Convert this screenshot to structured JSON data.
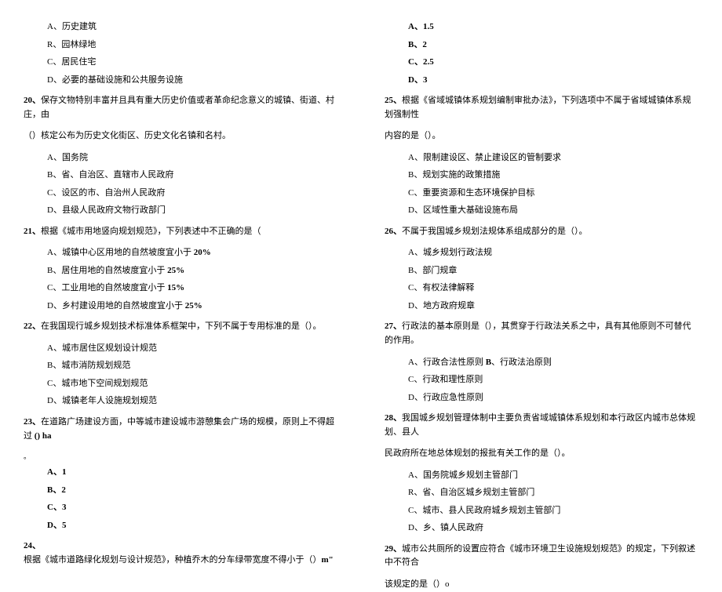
{
  "left": {
    "q19_optA": "A、历史建筑",
    "q19_optB": "R、园林绿地",
    "q19_optC": "C、居民住宅",
    "q19_optD": "D、必要的基础设施和公共服务设施",
    "q20_num": "20、",
    "q20_text1": "保存文物特别丰富并且具有重大历史价值或者革命纪念意义的城镇、街道、村庄，由",
    "q20_text2": "（）核定公布为历史文化街区、历史文化名镇和名村。",
    "q20_optA": "A、国务院",
    "q20_optB": "B、省、自治区、直辖市人民政府",
    "q20_optC": "C、设区的市、自治州人民政府",
    "q20_optD": "D、县级人民政府文物行政部门",
    "q21_num": "21、",
    "q21_text": "根据《城市用地竖向规划规范》，下列表述中不正确的是（",
    "q21_optA_pre": "A、城镇中心区用地的自然坡度宜小于 ",
    "q21_optA_val": "20%",
    "q21_optB_pre": "B、居住用地的自然坡度宜小于 ",
    "q21_optB_val": "25%",
    "q21_optC_pre": "C、工业用地的自然坡度宜小于 ",
    "q21_optC_val": "15%",
    "q21_optD_pre": "D、乡村建设用地的自然坡度宜小于 ",
    "q21_optD_val": "25%",
    "q22_num": "22、",
    "q22_text": "在我国现行城乡规划技术标准体系框架中，下列不属于专用标准的是（）。",
    "q22_optA": "A、城市居住区规划设计规范",
    "q22_optB": "B、城市消防规划规范",
    "q22_optC": "C、城市地下空间规划规范",
    "q22_optD": "D、城镇老年人设施规划规范",
    "q23_num": "23、",
    "q23_text1": "在道路广场建设方面，中等城市建设城市游憩集会广场的规模，原则上不得超过 ",
    "q23_ha": "() ha",
    "q23_dot": "。",
    "q23_optA": "A、1",
    "q23_optB": "B、2",
    "q23_optC": "C、3",
    "q23_optD": "D、5",
    "q24_num": "24、",
    "q24_text": "根据《城市道路绿化规划与设计规范》，种植乔木的分车绿带宽度不得小于（）",
    "q24_unit": "m\""
  },
  "right": {
    "q24_optA": "A、1.5",
    "q24_optB": "B、2",
    "q24_optC": "C、2.5",
    "q24_optD": "D、3",
    "q25_num": "25、",
    "q25_text1": "根据《省域城镇体系规划编制审批办法》，下列选项中不属于省域城镇体系规划强制性",
    "q25_text2": "内容的是（）。",
    "q25_optA": "A、限制建设区、禁止建设区的管制要求",
    "q25_optB": "B、规划实施的政策措施",
    "q25_optC": "C、重要资源和生态环境保护目标",
    "q25_optD": "D、区域性重大基础设施布局",
    "q26_num": "26、",
    "q26_text": "不属于我国城乡规划法规体系组成部分的是（）。",
    "q26_optA": "A、城乡规划行政法规",
    "q26_optB": "B、部门规章",
    "q26_optC": "C、有权法律解释",
    "q26_optD": "D、地方政府规章",
    "q27_num": "27、",
    "q27_text": "行政法的基本原则是（），其贯穿于行政法关系之中，具有其他原则不可替代的作用。",
    "q27_optA_pre": "A、行政合法性原则 ",
    "q27_optA_b": "B",
    "q27_optA_post": "、行政法治原则",
    "q27_optC": "C、行政和理性原则",
    "q27_optD": "D、行政应急性原则",
    "q28_num": "28、",
    "q28_text1": "我国城乡规划管理体制中主要负责省域城镇体系规划和本行政区内城市总体规划、县人",
    "q28_text2": "民政府所在地总体规划的报批有关工作的是（）。",
    "q28_optA": "A、国务院城乡规划主管部门",
    "q28_optB": "R、省、自治区城乡规划主管部门",
    "q28_optC": "C、城市、县人民政府城乡规划主管部门",
    "q28_optD": "D、乡、镇人民政府",
    "q29_num": "29、",
    "q29_text1": "城市公共厕所的设置应符合《城市环境卫生设施规划规范》的规定，下列叙述中不符合",
    "q29_text2": "该规定的是（）o"
  }
}
